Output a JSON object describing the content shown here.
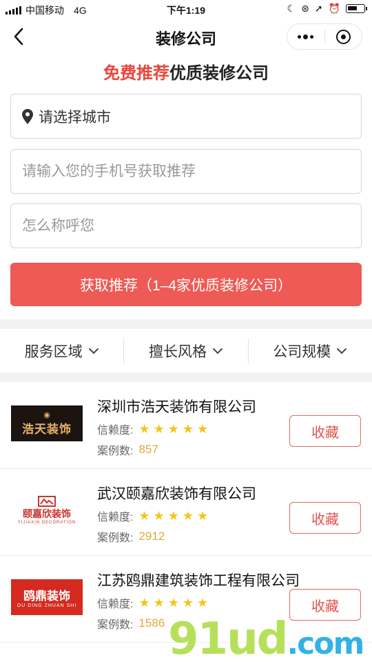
{
  "status_bar": {
    "carrier": "中国移动",
    "network": "4G",
    "time": "下午1:19"
  },
  "nav": {
    "title": "装修公司",
    "back_icon": "chevron-left-icon",
    "more_icon": "more-dots-icon",
    "close_icon": "target-icon"
  },
  "form": {
    "heading_highlight": "免费推荐",
    "heading_rest": "优质装修公司",
    "city_placeholder": "请选择城市",
    "phone_placeholder": "请输入您的手机号获取推荐",
    "name_placeholder": "怎么称呼您",
    "submit_label": "获取推荐（1–4家优质装修公司）"
  },
  "filters": [
    {
      "label": "服务区域"
    },
    {
      "label": "擅长风格"
    },
    {
      "label": "公司规模"
    }
  ],
  "companies": [
    {
      "name": "深圳市浩天装饰有限公司",
      "rating_label": "信赖度:",
      "rating": 5,
      "cases_label": "案例数:",
      "cases": "857",
      "logo_text": "浩天装饰",
      "logo_sub": "",
      "fav_label": "收藏"
    },
    {
      "name": "武汉颐嘉欣装饰有限公司",
      "rating_label": "信赖度:",
      "rating": 5,
      "cases_label": "案例数:",
      "cases": "2912",
      "logo_text": "颐嘉欣装饰",
      "logo_sub": "YIJIAXIN DECORATION",
      "fav_label": "收藏"
    },
    {
      "name": "江苏鸥鼎建筑装饰工程有限公司",
      "rating_label": "信赖度:",
      "rating": 5,
      "cases_label": "案例数:",
      "cases": "1586",
      "logo_text": "鸥鼎装饰",
      "logo_sub": "OU DING ZHUAN SHI",
      "fav_label": "收藏"
    }
  ],
  "watermark": {
    "text": "91ud",
    "suffix": ".com"
  },
  "colors": {
    "accent_red": "#ee5a55",
    "star_yellow": "#f4c418",
    "count_gold": "#e0a936"
  }
}
